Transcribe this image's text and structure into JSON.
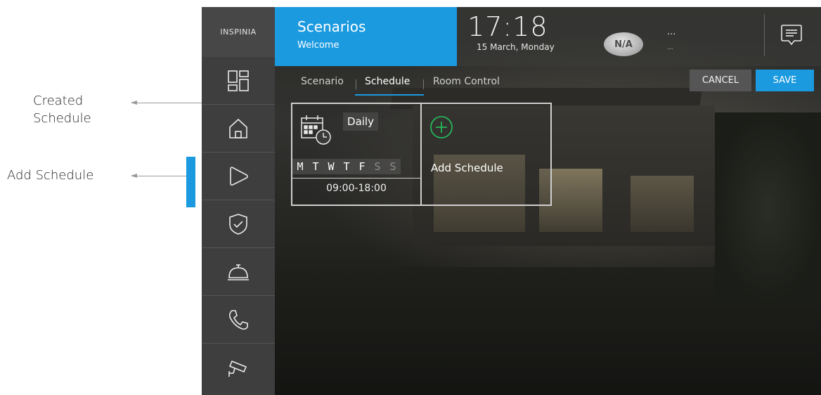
{
  "annotations": {
    "created_schedule": "Created\nSchedule",
    "add_schedule": "Add Schedule"
  },
  "sidebar": {
    "logo": "INSPINIA",
    "items": [
      {
        "icon": "dashboard-icon"
      },
      {
        "icon": "home-icon"
      },
      {
        "icon": "play-icon"
      },
      {
        "icon": "shield-check-icon"
      },
      {
        "icon": "service-bell-icon"
      },
      {
        "icon": "phone-icon"
      },
      {
        "icon": "security-camera-icon"
      }
    ]
  },
  "header": {
    "title": "Scenarios",
    "subtitle": "Welcome",
    "time": "17:18",
    "date": "15 March, Monday",
    "weather_badge": "N/A",
    "weather_value": "...",
    "weather_sub": "...",
    "message_icon": "message-icon"
  },
  "tabs": [
    {
      "label": "Scenario"
    },
    {
      "label": "Schedule",
      "active": true
    },
    {
      "label": "Room Control"
    }
  ],
  "actions": {
    "cancel": "CANCEL",
    "save": "SAVE"
  },
  "schedule_card": {
    "name": "Daily",
    "days": [
      {
        "label": "M",
        "on": true
      },
      {
        "label": "T",
        "on": true
      },
      {
        "label": "W",
        "on": true
      },
      {
        "label": "T",
        "on": true
      },
      {
        "label": "F",
        "on": true
      },
      {
        "label": "S",
        "on": false
      },
      {
        "label": "S",
        "on": false
      }
    ],
    "time_range": "09:00-18:00"
  },
  "add_card": {
    "label": "Add Schedule"
  },
  "colors": {
    "accent": "#1b9ae0",
    "sidebar": "#3e3e3e",
    "add_icon": "#22c55e"
  }
}
